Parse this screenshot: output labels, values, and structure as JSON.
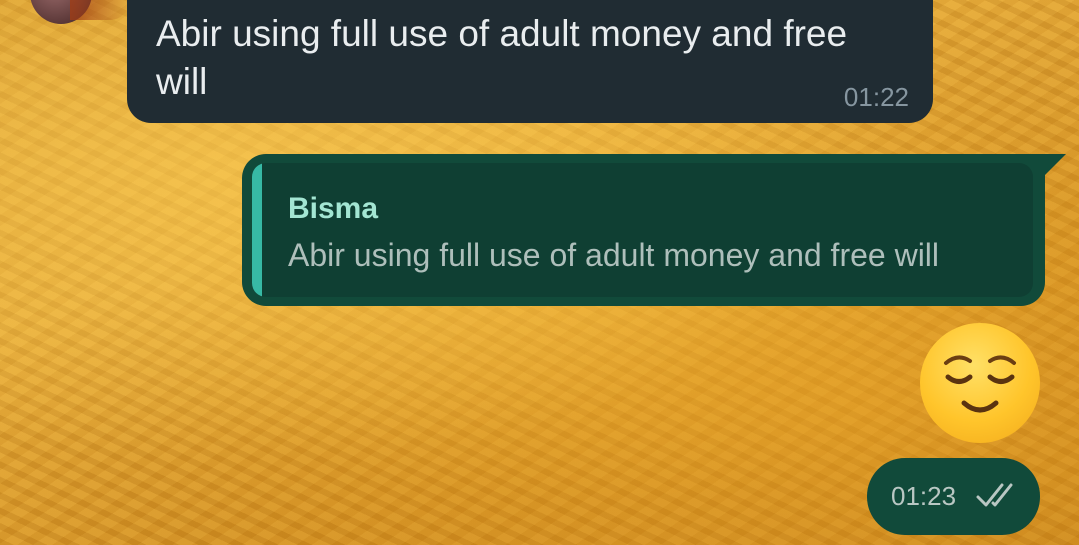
{
  "incoming_message": {
    "text": "Abir using full use of adult money and free will",
    "time": "01:22"
  },
  "outgoing_reply": {
    "quote_author": "Bisma",
    "quote_text": "Abir using full use of adult money and free will"
  },
  "outgoing_emoji": {
    "icon": "relieved-face-icon"
  },
  "outgoing_status": {
    "time": "01:23",
    "receipt_icon": "double-check-icon"
  },
  "colors": {
    "incoming_bubble": "#202c33",
    "outgoing_bubble": "#114a3a",
    "quote_bar": "#37b9a5",
    "quote_author": "#a3e6d3"
  }
}
